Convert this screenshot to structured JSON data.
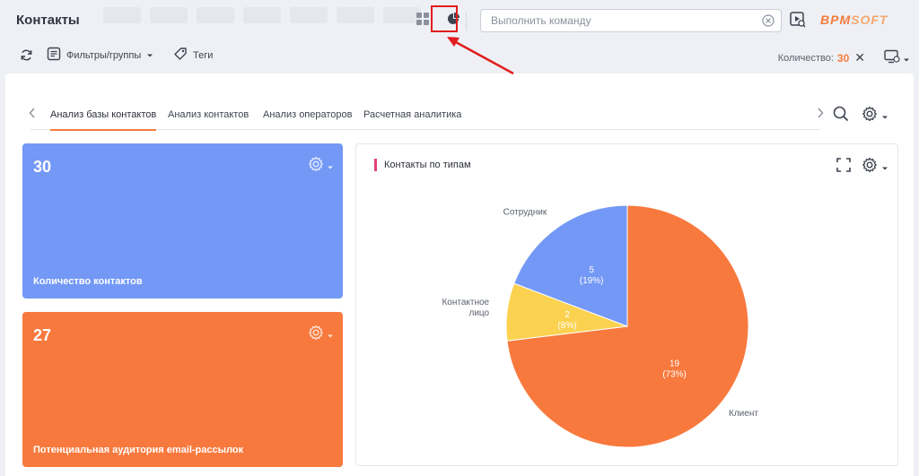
{
  "header": {
    "title": "Контакты",
    "command_placeholder": "Выполнить команду",
    "logo_main": "BPM",
    "logo_soft": "SOFT"
  },
  "toolbar": {
    "filters_label": "Фильтры/группы",
    "tags_label": "Теги",
    "count_label": "Количество:",
    "count_value": "30"
  },
  "tabs": [
    {
      "label": "Анализ базы контактов",
      "active": true
    },
    {
      "label": "Анализ контактов",
      "active": false
    },
    {
      "label": "Анализ операторов",
      "active": false
    },
    {
      "label": "Расчетная аналитика",
      "active": false
    }
  ],
  "cards": [
    {
      "value": "30",
      "label": "Количество контактов",
      "color": "#7398f5"
    },
    {
      "value": "27",
      "label": "Потенциальная аудитория email-рассылок",
      "color": "#f8793d"
    }
  ],
  "colors": {
    "accent": "#f47c3c",
    "highlight": "#e11d1d",
    "title_marker": "#e5417a"
  },
  "chart_data": {
    "type": "pie",
    "title": "Контакты по типам",
    "slices": [
      {
        "name": "Клиент",
        "value": 19,
        "percent": "73%",
        "color": "#f8793d"
      },
      {
        "name": "Контактное лицо",
        "value": 2,
        "percent": "8%",
        "color": "#fbd150"
      },
      {
        "name": "Сотрудник",
        "value": 5,
        "percent": "19%",
        "color": "#7398f5"
      }
    ]
  }
}
